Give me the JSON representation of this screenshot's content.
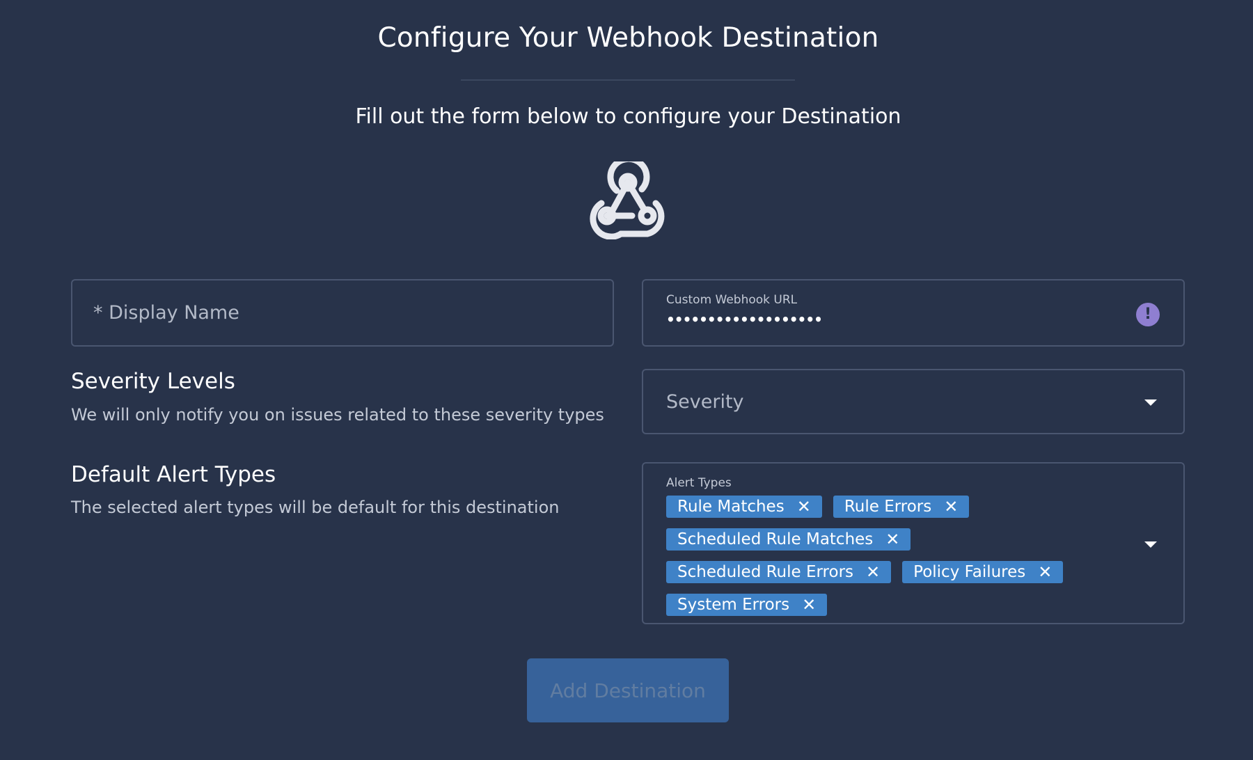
{
  "header": {
    "title": "Configure Your Webhook Destination",
    "subtitle": "Fill out the form below to configure your Destination"
  },
  "logo": {
    "icon": "webhook-icon"
  },
  "form": {
    "display_name": {
      "placeholder": "* Display Name",
      "value": ""
    },
    "webhook_url": {
      "label": "Custom Webhook URL",
      "masked_value": "•••••••••••••••••••",
      "status_icon": "exclamation-icon"
    },
    "severity": {
      "title": "Severity Levels",
      "description": "We will only notify you on issues related to these severity types",
      "placeholder": "Severity"
    },
    "alert_types": {
      "title": "Default Alert Types",
      "description": "The selected alert types will be default for this destination",
      "label": "Alert Types",
      "chips": [
        "Rule Matches",
        "Rule Errors",
        "Scheduled Rule Matches",
        "Scheduled Rule Errors",
        "Policy Failures",
        "System Errors"
      ],
      "remove_symbol": "✕"
    },
    "submit_label": "Add Destination"
  },
  "colors": {
    "background": "#28334a",
    "chip": "#3f82c7",
    "warning_icon": "#8f7fd1",
    "button": "#3a6ba8"
  }
}
